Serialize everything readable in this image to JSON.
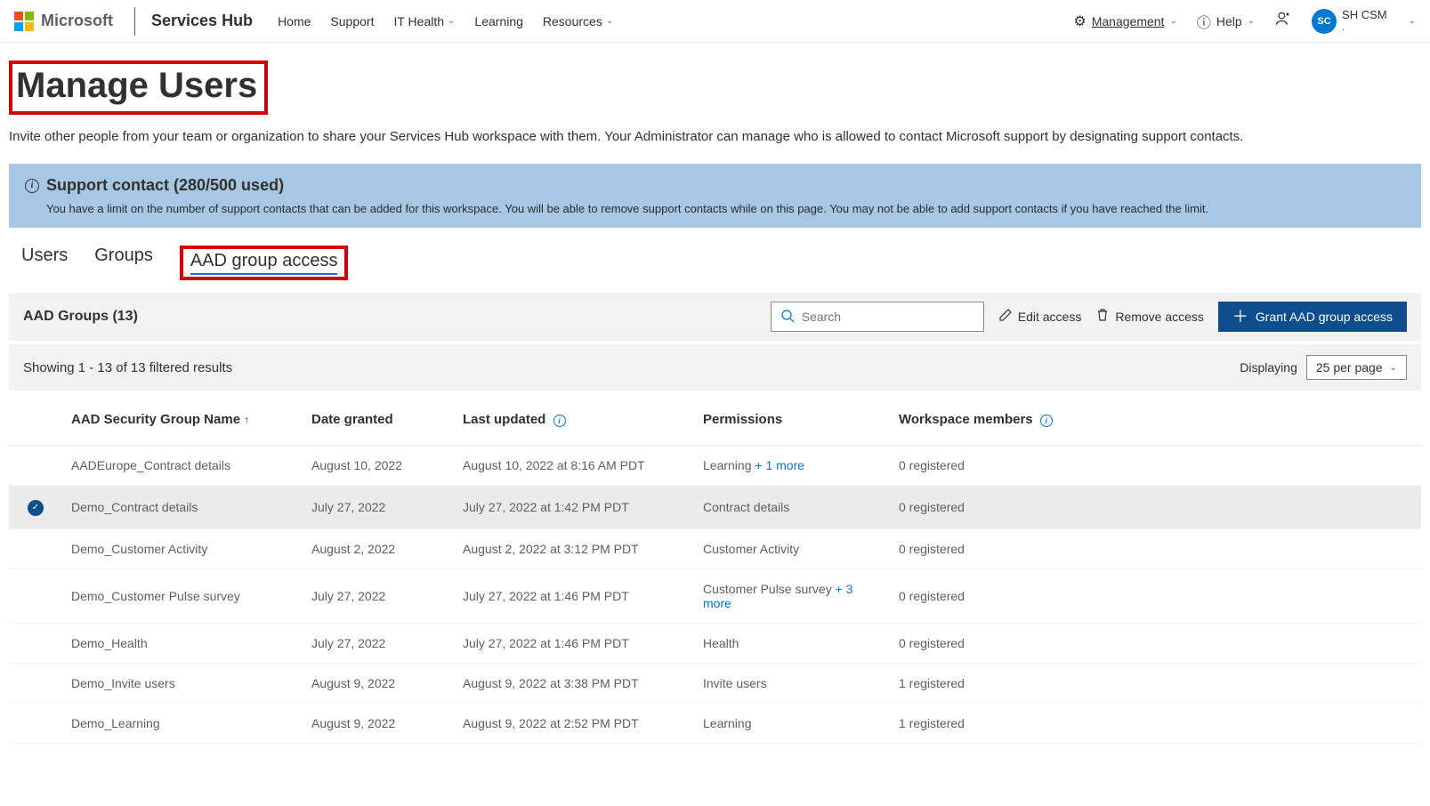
{
  "header": {
    "brand": "Microsoft",
    "app": "Services Hub",
    "nav": [
      "Home",
      "Support",
      "IT Health",
      "Learning",
      "Resources"
    ],
    "management": "Management",
    "help": "Help",
    "user_initials": "SC",
    "user_name": "SH CSM",
    "user_sub": "."
  },
  "page": {
    "title": "Manage Users",
    "desc": "Invite other people from your team or organization to share your Services Hub workspace with them. Your Administrator can manage who is allowed to contact Microsoft support by designating support contacts."
  },
  "banner": {
    "title": "Support contact (280/500 used)",
    "body": "You have a limit on the number of support contacts that can be added for this workspace. You will be able to remove support contacts while on this page. You may not be able to add support contacts if you have reached the limit."
  },
  "tabs": {
    "users": "Users",
    "groups": "Groups",
    "aad": "AAD group access"
  },
  "toolbar": {
    "title": "AAD Groups (13)",
    "search_placeholder": "Search",
    "edit": "Edit access",
    "remove": "Remove access",
    "grant": "Grant AAD group access"
  },
  "filter": {
    "text": "Showing 1 - 13 of 13 filtered results",
    "displaying": "Displaying",
    "per_page": "25 per page"
  },
  "columns": {
    "name": "AAD Security Group Name",
    "date": "Date granted",
    "updated": "Last updated",
    "permissions": "Permissions",
    "members": "Workspace members"
  },
  "rows": [
    {
      "selected": false,
      "name": "AADEurope_Contract details",
      "date": "August 10, 2022",
      "updated": "August 10, 2022 at 8:16 AM PDT",
      "perm": "Learning",
      "perm_more": "+ 1 more",
      "members": "0 registered"
    },
    {
      "selected": true,
      "name": "Demo_Contract details",
      "date": "July 27, 2022",
      "updated": "July 27, 2022 at 1:42 PM PDT",
      "perm": "Contract details",
      "perm_more": "",
      "members": "0 registered"
    },
    {
      "selected": false,
      "name": "Demo_Customer Activity",
      "date": "August 2, 2022",
      "updated": "August 2, 2022 at 3:12 PM PDT",
      "perm": "Customer Activity",
      "perm_more": "",
      "members": "0 registered"
    },
    {
      "selected": false,
      "name": "Demo_Customer Pulse survey",
      "date": "July 27, 2022",
      "updated": "July 27, 2022 at 1:46 PM PDT",
      "perm": "Customer Pulse survey",
      "perm_more": "+ 3 more",
      "members": "0 registered"
    },
    {
      "selected": false,
      "name": "Demo_Health",
      "date": "July 27, 2022",
      "updated": "July 27, 2022 at 1:46 PM PDT",
      "perm": "Health",
      "perm_more": "",
      "members": "0 registered"
    },
    {
      "selected": false,
      "name": "Demo_Invite users",
      "date": "August 9, 2022",
      "updated": "August 9, 2022 at 3:38 PM PDT",
      "perm": "Invite users",
      "perm_more": "",
      "members": "1 registered"
    },
    {
      "selected": false,
      "name": "Demo_Learning",
      "date": "August 9, 2022",
      "updated": "August 9, 2022 at 2:52 PM PDT",
      "perm": "Learning",
      "perm_more": "",
      "members": "1 registered"
    }
  ]
}
